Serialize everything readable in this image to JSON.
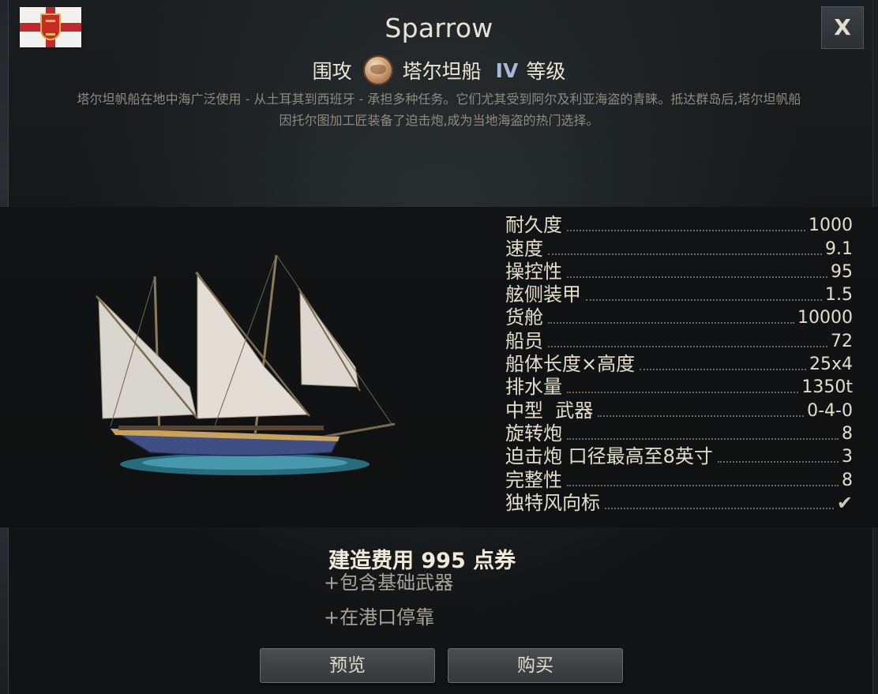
{
  "window": {
    "title": "Sparrow",
    "close_label": "X"
  },
  "subtitle": {
    "role": "围攻",
    "ship_class": "塔尔坦船",
    "tier": "IV",
    "tier_suffix": "等级"
  },
  "description": "塔尔坦帆船在地中海广泛使用 - 从土耳其到西班牙 - 承担多种任务。它们尤其受到阿尔及利亚海盗的青睐。抵达群岛后,塔尔坦帆船因托尔图加工匠装备了迫击炮,成为当地海盗的热门选择。",
  "stats": [
    {
      "label": "耐久度",
      "value": "1000"
    },
    {
      "label": "速度",
      "value": "9.1"
    },
    {
      "label": "操控性",
      "value": "95"
    },
    {
      "label": "舷侧装甲",
      "value": "1.5"
    },
    {
      "label": "货舱",
      "value": "10000"
    },
    {
      "label": "船员",
      "value": "72"
    },
    {
      "label": "船体长度×高度",
      "value": "25x4"
    },
    {
      "label": "排水量",
      "value": "1350t"
    },
    {
      "label": "中型  武器",
      "value": "0-4-0"
    },
    {
      "label": "旋转炮",
      "value": "8"
    },
    {
      "label": "迫击炮 口径最高至8英寸",
      "value": "3"
    },
    {
      "label": "完整性",
      "value": "8"
    },
    {
      "label": "独特风向标",
      "value": "✔"
    }
  ],
  "cost": "建造费用 995 点券",
  "bonuses": [
    "+包含基础武器",
    "+在港口停靠"
  ],
  "buttons": {
    "preview": "预览",
    "buy": "购买"
  }
}
